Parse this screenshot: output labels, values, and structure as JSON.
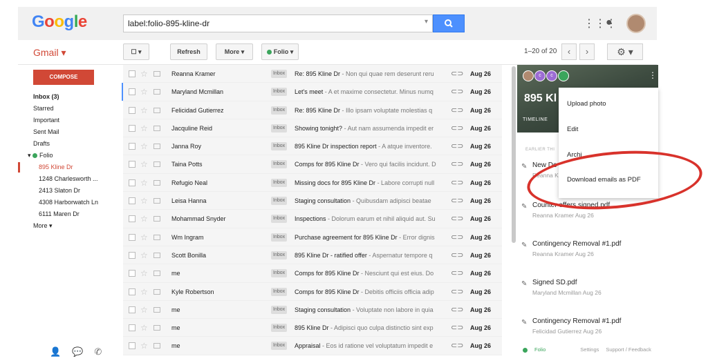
{
  "header": {
    "logo": "Google",
    "search_value": "label:folio-895-kline-dr",
    "icons": [
      "apps-grid-icon",
      "notifications-icon",
      "search-icon"
    ]
  },
  "toolbar": {
    "gmail_label": "Gmail ▾",
    "select_label": "☐ ▾",
    "refresh_label": "Refresh",
    "more_label": "More ▾",
    "folio_label": "Folio ▾",
    "pager": "1–20 of 20"
  },
  "nav": {
    "compose": "COMPOSE",
    "items": [
      {
        "label": "Inbox (3)",
        "bold": true
      },
      {
        "label": "Starred"
      },
      {
        "label": "Important"
      },
      {
        "label": "Sent Mail"
      },
      {
        "label": "Drafts"
      },
      {
        "label": "Folio"
      },
      {
        "label": "895 Kline Dr",
        "active": true
      },
      {
        "label": "1248 Charlesworth ..."
      },
      {
        "label": "2413 Slaton Dr"
      },
      {
        "label": "4308 Harborwatch Ln"
      },
      {
        "label": "6111 Maren Dr"
      },
      {
        "label": "More ▾"
      }
    ]
  },
  "emails": [
    {
      "sender": "Reanna Kramer",
      "badge": "Inbox",
      "subject": "Re: 895 Kline Dr",
      "snippet": " - Non qui quae rem deserunt reru",
      "date": "Aug 26"
    },
    {
      "sender": "Maryland Mcmillan",
      "badge": "Inbox",
      "subject": "Let's meet",
      "snippet": " - A et maxime consectetur. Minus numq",
      "date": "Aug 26"
    },
    {
      "sender": "Felicidad Gutierrez",
      "badge": "Inbox",
      "subject": "Re: 895 Kline Dr",
      "snippet": " - Illo ipsam voluptate molestias q",
      "date": "Aug 26"
    },
    {
      "sender": "Jacquline Reid",
      "badge": "Inbox",
      "subject": "Showing tonight?",
      "snippet": " - Aut nam assumenda impedit er",
      "date": "Aug 26"
    },
    {
      "sender": "Janna Roy",
      "badge": "Inbox",
      "subject": "895 Kline Dr inspection report",
      "snippet": " - A atque inventore.",
      "date": "Aug 26"
    },
    {
      "sender": "Taina Potts",
      "badge": "Inbox",
      "subject": "Comps for 895 Kline Dr",
      "snippet": " - Vero qui facilis incidunt. D",
      "date": "Aug 26"
    },
    {
      "sender": "Refugio Neal",
      "badge": "Inbox",
      "subject": "Missing docs for 895 Kline Dr",
      "snippet": " - Labore corrupti null",
      "date": "Aug 26"
    },
    {
      "sender": "Leisa Hanna",
      "badge": "Inbox",
      "subject": "Staging consultation",
      "snippet": " - Quibusdam adipisci beatae",
      "date": "Aug 26"
    },
    {
      "sender": "Mohammad Snyder",
      "badge": "Inbox",
      "subject": "Inspections",
      "snippet": " - Dolorum earum et nihil aliquid aut. Su",
      "date": "Aug 26"
    },
    {
      "sender": "Wm Ingram",
      "badge": "Inbox",
      "subject": "Purchase agreement for 895 Kline Dr",
      "snippet": " - Error dignis",
      "date": "Aug 26"
    },
    {
      "sender": "Scott Bonilla",
      "badge": "Inbox",
      "subject": "895 Kline Dr - ratified offer",
      "snippet": " - Aspernatur tempore q",
      "date": "Aug 26"
    },
    {
      "sender": "me",
      "badge": "Inbox",
      "subject": "Comps for 895 Kline Dr",
      "snippet": " - Nesciunt qui est eius. Do",
      "date": "Aug 26"
    },
    {
      "sender": "Kyle Robertson",
      "badge": "Inbox",
      "subject": "Comps for 895 Kline Dr",
      "snippet": " - Debitis officiis officia adip",
      "date": "Aug 26"
    },
    {
      "sender": "me",
      "badge": "Inbox",
      "subject": "Staging consultation",
      "snippet": " - Voluptate non labore in quia",
      "date": "Aug 26"
    },
    {
      "sender": "me",
      "badge": "Inbox",
      "subject": "895 Kline Dr",
      "snippet": " - Adipisci quo culpa distinctio sint exp",
      "date": "Aug 26"
    },
    {
      "sender": "me",
      "badge": "Inbox",
      "subject": "Appraisal",
      "snippet": " - Eos id ratione vel voluptatum impedit e",
      "date": "Aug 26"
    }
  ],
  "panel": {
    "title": "895 Kl",
    "timeline_tab": "TIMELINE",
    "earlier": "EARLIER THI",
    "avatars": [
      {
        "letter": "",
        "color": "#b08a70"
      },
      {
        "letter": "c",
        "color": "#9c6cd4"
      },
      {
        "letter": "c",
        "color": "#9c6cd4"
      },
      {
        "letter": "",
        "color": "#3ba55c"
      }
    ],
    "attachments": [
      {
        "name": "New Do",
        "meta": "Reanna K"
      },
      {
        "name": "Counter offers signed.pdf",
        "meta": "Reanna Kramer   Aug 26"
      },
      {
        "name": "Contingency Removal #1.pdf",
        "meta": "Reanna Kramer   Aug 26"
      },
      {
        "name": "Signed SD.pdf",
        "meta": "Maryland Mcmillan   Aug 26"
      },
      {
        "name": "Contingency Removal #1.pdf",
        "meta": "Felicidad Gutierrez   Aug 26"
      }
    ],
    "footer": {
      "folio": "Folio",
      "settings": "Settings",
      "support": "Support / Feedback"
    }
  },
  "context_menu": {
    "items": [
      "Upload photo",
      "Edit",
      "Archi",
      "Download emails as PDF"
    ]
  },
  "colors": {
    "accent": "#d14836",
    "blue": "#4d90fe",
    "folio_green": "#3ba55c",
    "highlight": "#d8322b"
  }
}
